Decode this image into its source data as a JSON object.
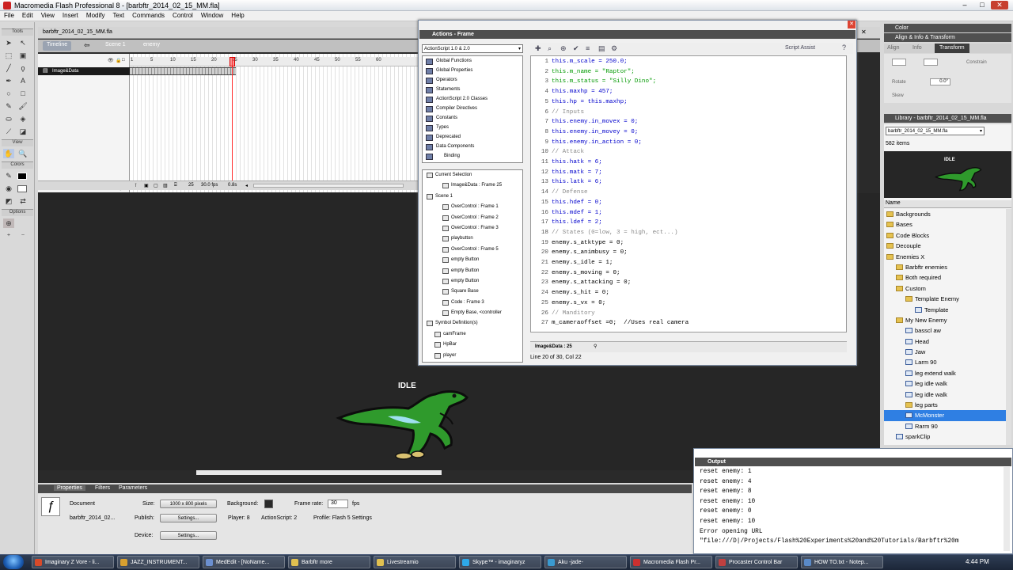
{
  "window": {
    "title": "Macromedia Flash Professional 8 - [barbftr_2014_02_15_MM.fla]"
  },
  "menu": [
    "File",
    "Edit",
    "View",
    "Insert",
    "Modify",
    "Text",
    "Commands",
    "Control",
    "Window",
    "Help"
  ],
  "tools": {
    "tools_label": "Tools",
    "view_label": "View",
    "colors_label": "Colors",
    "options_label": "Options"
  },
  "doc": {
    "tab": "barbftr_2014_02_15_MM.fla",
    "timeline_label": "Timeline",
    "scene": "Scene 1",
    "symbol": "enemy",
    "layer": "Image&Data",
    "ruler": [
      "1",
      "5",
      "10",
      "15",
      "20",
      "25",
      "30",
      "35",
      "40",
      "45",
      "50",
      "55",
      "60"
    ],
    "frame": "25",
    "fps": "30.0 fps",
    "time": "0.8s"
  },
  "stage": {
    "idle_label": "IDLE"
  },
  "actions": {
    "title": "Actions - Frame",
    "version": "ActionScript 1.0 & 2.0",
    "script_assist": "Script Assist",
    "book": [
      "Global Functions",
      "Global Properties",
      "Operators",
      "Statements",
      "ActionScript 2.0 Classes",
      "Compiler Directives",
      "Constants",
      "Types",
      "Deprecated",
      "Data Components",
      "Binding"
    ],
    "tree": [
      {
        "label": "Current Selection",
        "indent": 0
      },
      {
        "label": "Image&Data : Frame 25",
        "indent": 2
      },
      {
        "label": "Scene 1",
        "indent": 0
      },
      {
        "label": "OverControl : Frame 1",
        "indent": 2
      },
      {
        "label": "OverControl : Frame 2",
        "indent": 2
      },
      {
        "label": "OverControl : Frame 3",
        "indent": 2
      },
      {
        "label": "playbutton",
        "indent": 2
      },
      {
        "label": "OverControl : Frame 5",
        "indent": 2
      },
      {
        "label": "empty Button",
        "indent": 2
      },
      {
        "label": "empty Button",
        "indent": 2
      },
      {
        "label": "empty Button",
        "indent": 2
      },
      {
        "label": "Square Base",
        "indent": 2
      },
      {
        "label": "Code : Frame 3",
        "indent": 2
      },
      {
        "label": "Empty Base, <controller",
        "indent": 2
      },
      {
        "label": "Symbol Definition(s)",
        "indent": 0
      },
      {
        "label": "camFrame",
        "indent": 1
      },
      {
        "label": "HpBar",
        "indent": 1
      },
      {
        "label": "player",
        "indent": 1
      }
    ],
    "code": [
      {
        "n": "1",
        "t": "this.m_scale = 250.0;",
        "c": "kw"
      },
      {
        "n": "2",
        "t": "this.m_name = \"Raptor\";",
        "c": "st"
      },
      {
        "n": "3",
        "t": "this.m_status = \"Silly Dino\";",
        "c": "st"
      },
      {
        "n": "4",
        "t": "this.maxhp = 457;",
        "c": "kw"
      },
      {
        "n": "5",
        "t": "this.hp = this.maxhp;",
        "c": "kw"
      },
      {
        "n": "6",
        "t": "// Inputs",
        "c": "cm"
      },
      {
        "n": "7",
        "t": "this.enemy.in_movex = 0;",
        "c": "kw"
      },
      {
        "n": "8",
        "t": "this.enemy.in_movey = 0;",
        "c": "kw"
      },
      {
        "n": "9",
        "t": "this.enemy.in_action = 0;",
        "c": "kw"
      },
      {
        "n": "10",
        "t": "// Attack",
        "c": "cm"
      },
      {
        "n": "11",
        "t": "this.hatk = 6;",
        "c": "kw"
      },
      {
        "n": "12",
        "t": "this.matk = 7;",
        "c": "kw"
      },
      {
        "n": "13",
        "t": "this.latk = 6;",
        "c": "kw"
      },
      {
        "n": "14",
        "t": "// Defense",
        "c": "cm"
      },
      {
        "n": "15",
        "t": "this.hdef = 0;",
        "c": "kw"
      },
      {
        "n": "16",
        "t": "this.mdef = 1;",
        "c": "kw"
      },
      {
        "n": "17",
        "t": "this.ldef = 2;",
        "c": "kw"
      },
      {
        "n": "18",
        "t": "// States (0=low, 3 = high, ect...)",
        "c": "cm"
      },
      {
        "n": "19",
        "t": "enemy.s_atktype = 0;",
        "c": ""
      },
      {
        "n": "20",
        "t": "enemy.s_animbusy = 0;",
        "c": ""
      },
      {
        "n": "21",
        "t": "enemy.s_idle = 1;",
        "c": ""
      },
      {
        "n": "22",
        "t": "enemy.s_moving = 0;",
        "c": ""
      },
      {
        "n": "23",
        "t": "enemy.s_attacking = 0;",
        "c": ""
      },
      {
        "n": "24",
        "t": "enemy.s_hit = 0;",
        "c": ""
      },
      {
        "n": "25",
        "t": "enemy.s_vx = 0;",
        "c": ""
      },
      {
        "n": "26",
        "t": "// Manditory",
        "c": "cm"
      },
      {
        "n": "27",
        "t": "m_cameraoffset =0;  //Uses real camera",
        "c": ""
      }
    ],
    "code_tab": "Image&Data : 25",
    "status": "Line 20 of 30, Col 22"
  },
  "right": {
    "color_label": "Color",
    "align_label": "Align & Info & Transform",
    "tabs": [
      "Align",
      "Info",
      "Transform"
    ],
    "rotate": "Rotate",
    "rotate_val": "0.0°",
    "skew": "Skew",
    "constrain": "Constrain",
    "library_label": "Library - barbftr_2014_02_15_MM.fla",
    "lib_file": "barbftr_2014_02_15_MM.fla",
    "lib_count": "582 items",
    "preview_label": "IDLE",
    "name_header": "Name",
    "items": [
      {
        "label": "Backgrounds",
        "kind": "fold",
        "indent": 0
      },
      {
        "label": "Bases",
        "kind": "fold",
        "indent": 0
      },
      {
        "label": "Code Blocks",
        "kind": "fold",
        "indent": 0
      },
      {
        "label": "Decouple",
        "kind": "fold",
        "indent": 0
      },
      {
        "label": "Enemies X",
        "kind": "fold",
        "indent": 0
      },
      {
        "label": "Barbftr enemies",
        "kind": "fold",
        "indent": 1
      },
      {
        "label": "Both required",
        "kind": "fold",
        "indent": 1
      },
      {
        "label": "Custom",
        "kind": "fold",
        "indent": 1
      },
      {
        "label": "Template Enemy",
        "kind": "fold",
        "indent": 2
      },
      {
        "label": "Template",
        "kind": "sym",
        "indent": 3
      },
      {
        "label": "My New Enemy",
        "kind": "fold",
        "indent": 1
      },
      {
        "label": "basscl aw",
        "kind": "sym",
        "indent": 2
      },
      {
        "label": "Head",
        "kind": "sym",
        "indent": 2
      },
      {
        "label": "Jaw",
        "kind": "sym",
        "indent": 2
      },
      {
        "label": "Larm 90",
        "kind": "sym",
        "indent": 2
      },
      {
        "label": "leg extend walk",
        "kind": "sym",
        "indent": 2
      },
      {
        "label": "leg idle walk",
        "kind": "sym",
        "indent": 2
      },
      {
        "label": "leg idle walk",
        "kind": "sym",
        "indent": 2
      },
      {
        "label": "leg parts",
        "kind": "fold",
        "indent": 2
      },
      {
        "label": "McMonster",
        "kind": "sym",
        "indent": 2,
        "sel": true
      },
      {
        "label": "Rarm 90",
        "kind": "sym",
        "indent": 2
      },
      {
        "label": "sparkClip",
        "kind": "sym",
        "indent": 1
      }
    ]
  },
  "output": {
    "title": "Output",
    "lines": [
      "reset enemy: 1",
      "reset enemy: 4",
      "reset enemy: 8",
      "reset enemy: 10",
      "reset enemy: 0",
      "reset enemy: 10",
      "Error opening URL",
      "\"file:///D|/Projects/Flash%20Experiments%20and%20Tutorials/Barbftr%20m"
    ]
  },
  "props": {
    "tabs": [
      "Properties",
      "Filters",
      "Parameters"
    ],
    "doc_label": "Document",
    "doc_name": "barbftr_2014_02...",
    "size_label": "Size:",
    "size_val": "1000 x 800 pixels",
    "bg_label": "Background:",
    "fr_label": "Frame rate:",
    "fr_val": "30",
    "fps": "fps",
    "publish_label": "Publish:",
    "settings": "Settings...",
    "player": "Player: 8",
    "as": "ActionScript: 2",
    "profile": "Profile: Flash 5 Settings",
    "device_label": "Device:"
  },
  "taskbar": {
    "items": [
      {
        "label": "Imaginary Z Vore - li...",
        "color": "#d84a2a"
      },
      {
        "label": "JAZZ_INSTRUMENT...",
        "color": "#d8a030"
      },
      {
        "label": "MedEdit - [NoName...",
        "color": "#6b8fd0"
      },
      {
        "label": "Barbftr more",
        "color": "#e0c050"
      },
      {
        "label": "Livestreamio",
        "color": "#e0c050"
      },
      {
        "label": "Skype™ - imaginaryz",
        "color": "#2ea8e8"
      },
      {
        "label": "Aku -jade-",
        "color": "#3a9ad0"
      },
      {
        "label": "Macromedia Flash Pr...",
        "color": "#cc3030"
      },
      {
        "label": "Procaster Control Bar",
        "color": "#c04040"
      },
      {
        "label": "HOW TO.txt - Notep...",
        "color": "#5a8ac8"
      }
    ],
    "clock": "4:44 PM"
  }
}
